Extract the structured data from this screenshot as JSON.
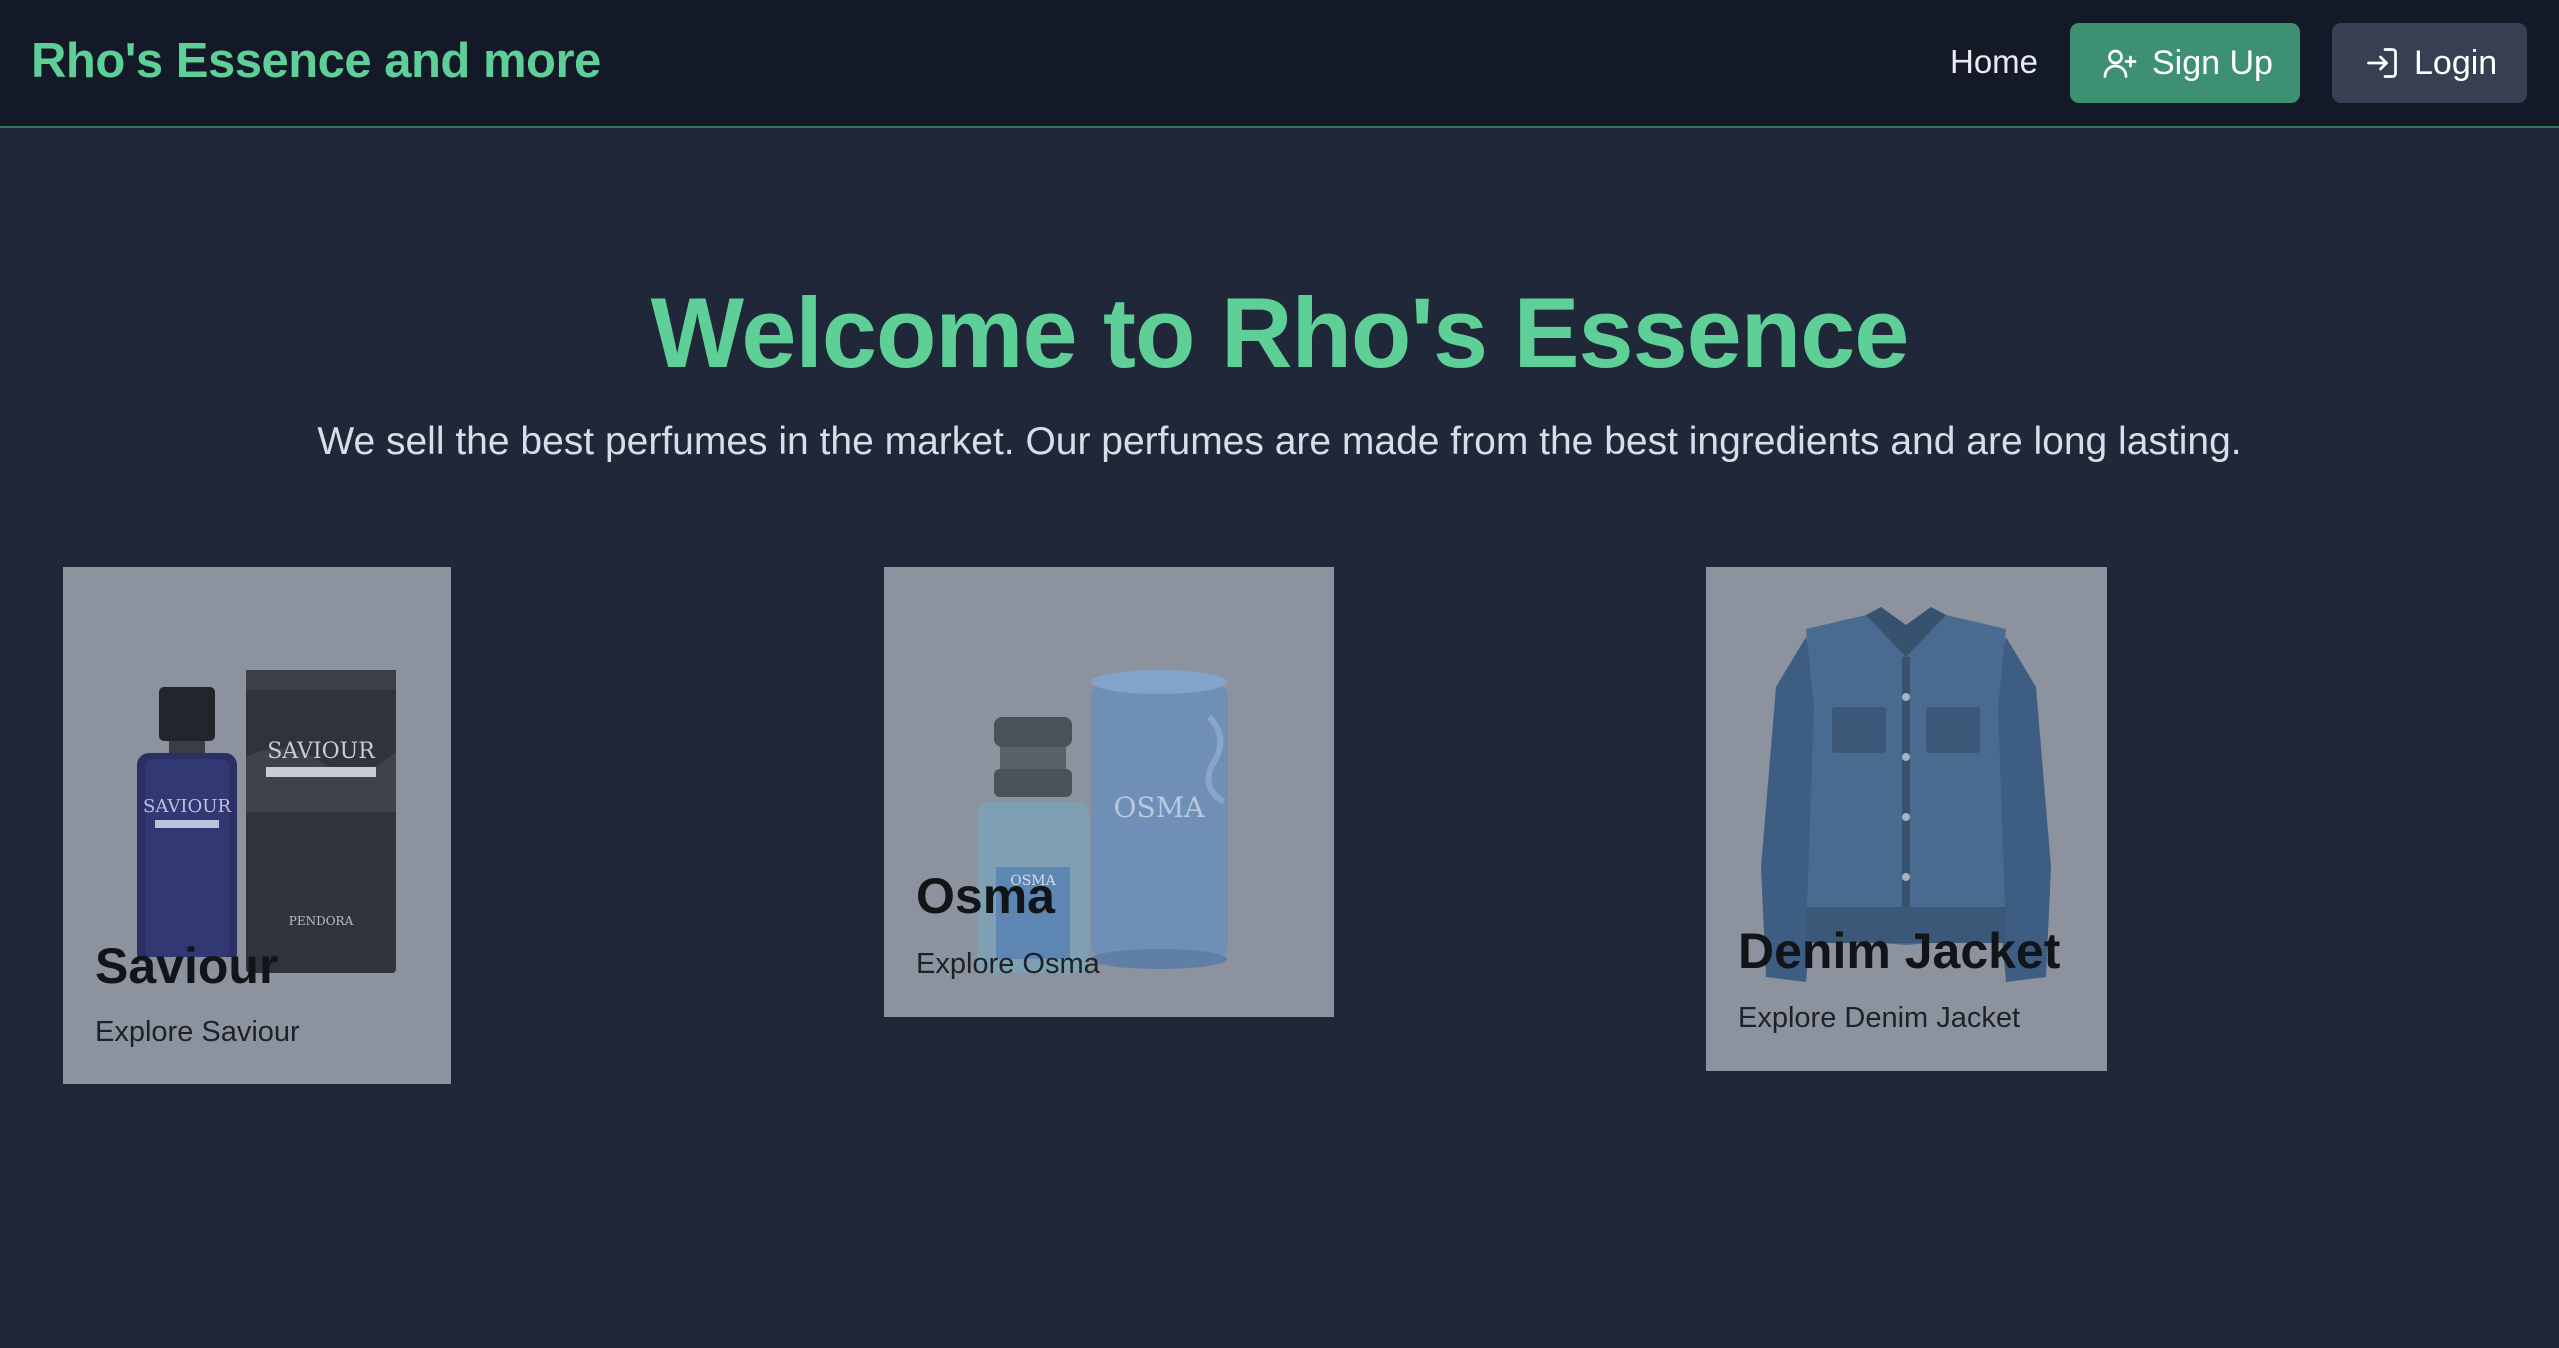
{
  "navbar": {
    "brand": "Rho's Essence and more",
    "home_label": "Home",
    "signup_label": "Sign Up",
    "login_label": "Login",
    "signup_icon": "user-plus-icon",
    "login_icon": "log-in-icon"
  },
  "hero": {
    "title": "Welcome to Rho's Essence",
    "subtitle": "We sell the best perfumes in the market. Our perfumes are made from the best ingredients and are long lasting."
  },
  "products": [
    {
      "name": "Saviour",
      "link": "Explore Saviour",
      "image": "saviour-perfume-image"
    },
    {
      "name": "Osma",
      "link": "Explore Osma",
      "image": "osma-perfume-image"
    },
    {
      "name": "Denim Jacket",
      "link": "Explore Denim Jacket",
      "image": "denim-jacket-image"
    }
  ],
  "product_image_text": {
    "saviour_bottle": "SAVIOUR",
    "saviour_box": "SAVIOUR",
    "saviour_brand": "PENDORA",
    "osma_box": "OSMA",
    "osma_bottle": "OSMA"
  },
  "colors": {
    "accent": "#5fcf98",
    "page_background": "#1f2738",
    "navbar_background": "#131927",
    "signup_button": "#3d9071",
    "login_button": "#374053",
    "card_background": "#8c939e"
  }
}
